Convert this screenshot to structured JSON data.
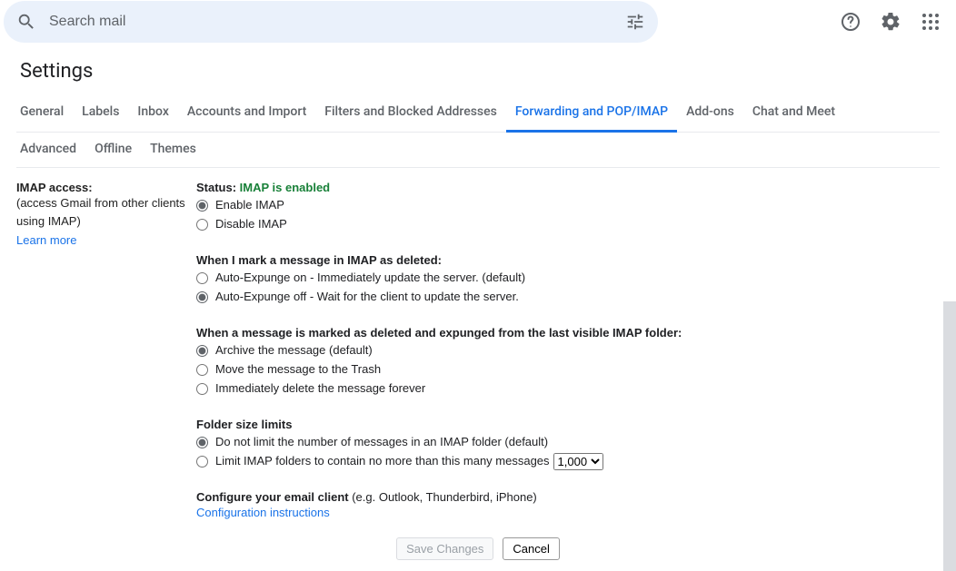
{
  "search": {
    "placeholder": "Search mail"
  },
  "pageTitle": "Settings",
  "tabs": [
    "General",
    "Labels",
    "Inbox",
    "Accounts and Import",
    "Filters and Blocked Addresses",
    "Forwarding and POP/IMAP",
    "Add-ons",
    "Chat and Meet"
  ],
  "tabs2": [
    "Advanced",
    "Offline",
    "Themes"
  ],
  "activeTab": "Forwarding and POP/IMAP",
  "left": {
    "title": "IMAP access:",
    "sub": "(access Gmail from other clients using IMAP)",
    "learn": "Learn more"
  },
  "status": {
    "label": "Status: ",
    "value": "IMAP is enabled"
  },
  "enableGroup": {
    "opt1": "Enable IMAP",
    "opt2": "Disable IMAP"
  },
  "deletedGroup": {
    "head": "When I mark a message in IMAP as deleted:",
    "opt1": "Auto-Expunge on - Immediately update the server. (default)",
    "opt2": "Auto-Expunge off - Wait for the client to update the server."
  },
  "expungedGroup": {
    "head": "When a message is marked as deleted and expunged from the last visible IMAP folder:",
    "opt1": "Archive the message (default)",
    "opt2": "Move the message to the Trash",
    "opt3": "Immediately delete the message forever"
  },
  "folderGroup": {
    "head": "Folder size limits",
    "opt1": "Do not limit the number of messages in an IMAP folder (default)",
    "opt2": "Limit IMAP folders to contain no more than this many messages",
    "selectValue": "1,000"
  },
  "config": {
    "bold": "Configure your email client",
    "rest": " (e.g. Outlook, Thunderbird, iPhone)",
    "link": "Configuration instructions"
  },
  "buttons": {
    "save": "Save Changes",
    "cancel": "Cancel"
  }
}
